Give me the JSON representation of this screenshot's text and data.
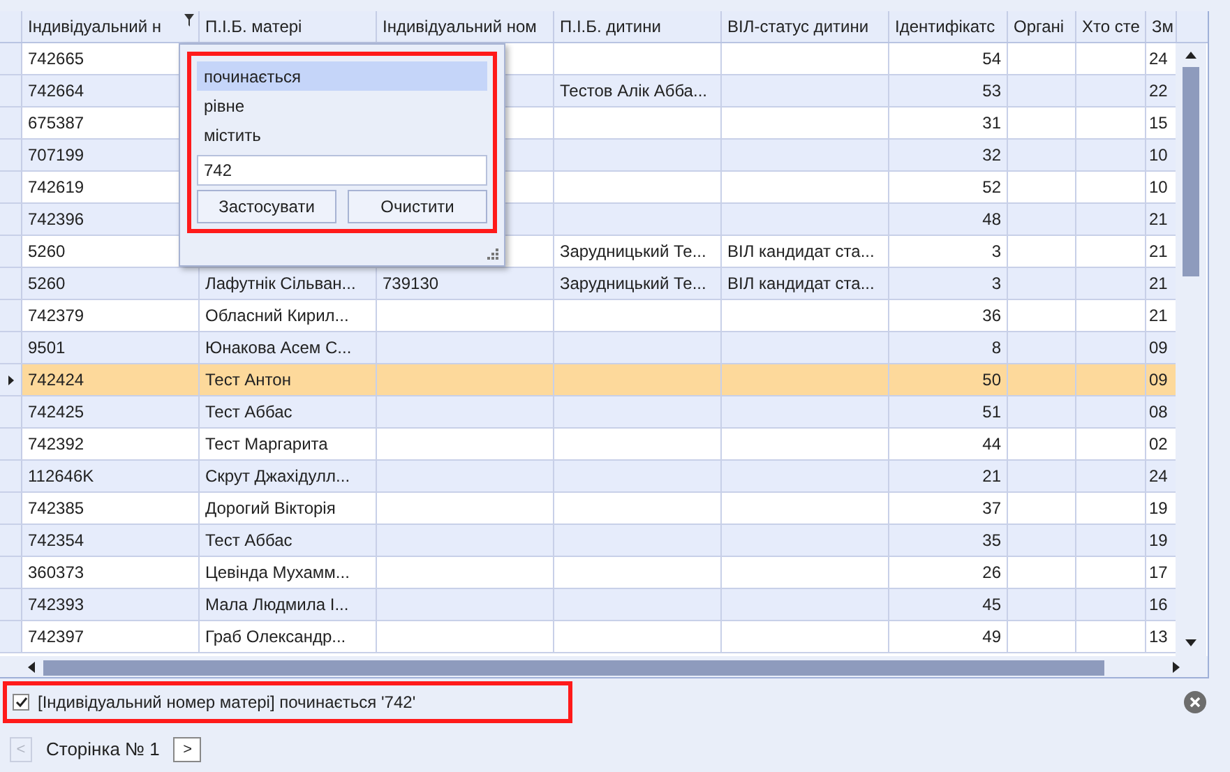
{
  "grid": {
    "columns": [
      {
        "label": "Індивідуальний н",
        "filtered": true,
        "kind": "text"
      },
      {
        "label": "П.І.Б. матері",
        "filtered": false,
        "kind": "text"
      },
      {
        "label": "Індивідуальний ном",
        "filtered": false,
        "kind": "text"
      },
      {
        "label": "П.І.Б. дитини",
        "filtered": false,
        "kind": "text"
      },
      {
        "label": "ВІЛ-статус дитини",
        "filtered": false,
        "kind": "text"
      },
      {
        "label": "Ідентифікатс",
        "filtered": false,
        "kind": "number"
      },
      {
        "label": "Органі",
        "filtered": false,
        "kind": "text"
      },
      {
        "label": "Хто сте",
        "filtered": false,
        "kind": "text"
      },
      {
        "label": "Зм",
        "filtered": false,
        "kind": "text"
      }
    ],
    "rows": [
      {
        "selected": false,
        "cells": [
          "742665",
          null,
          null,
          null,
          null,
          "54",
          null,
          null,
          "24"
        ]
      },
      {
        "selected": false,
        "cells": [
          "742664",
          null,
          null,
          "Тестов Алік Абба...",
          null,
          "53",
          null,
          null,
          "22"
        ]
      },
      {
        "selected": false,
        "cells": [
          "675387",
          null,
          null,
          null,
          null,
          "31",
          null,
          null,
          "15"
        ]
      },
      {
        "selected": false,
        "cells": [
          "707199",
          null,
          null,
          null,
          null,
          "32",
          null,
          null,
          "10"
        ]
      },
      {
        "selected": false,
        "cells": [
          "742619",
          null,
          null,
          null,
          null,
          "52",
          null,
          null,
          "10"
        ]
      },
      {
        "selected": false,
        "cells": [
          "742396",
          null,
          null,
          null,
          null,
          "48",
          null,
          null,
          "21"
        ]
      },
      {
        "selected": false,
        "cells": [
          "5260",
          null,
          null,
          "Зарудницький Те...",
          "ВІЛ кандидат ста...",
          "3",
          null,
          null,
          "21"
        ]
      },
      {
        "selected": false,
        "cells": [
          "5260",
          "Лафутнік Сільван...",
          "739130",
          "Зарудницький Те...",
          "ВІЛ кандидат ста...",
          "3",
          null,
          null,
          "21"
        ]
      },
      {
        "selected": false,
        "cells": [
          "742379",
          "Обласний Кирил...",
          null,
          null,
          null,
          "36",
          null,
          null,
          "21"
        ]
      },
      {
        "selected": false,
        "cells": [
          "9501",
          "Юнакова Асем С...",
          null,
          null,
          null,
          "8",
          null,
          null,
          "09"
        ]
      },
      {
        "selected": true,
        "cells": [
          "742424",
          "Тест Антон",
          null,
          null,
          null,
          "50",
          null,
          null,
          "09"
        ]
      },
      {
        "selected": false,
        "cells": [
          "742425",
          "Тест Аббас",
          null,
          null,
          null,
          "51",
          null,
          null,
          "08"
        ]
      },
      {
        "selected": false,
        "cells": [
          "742392",
          "Тест Маргарита",
          null,
          null,
          null,
          "44",
          null,
          null,
          "02"
        ]
      },
      {
        "selected": false,
        "cells": [
          "112646K",
          "Скрут Джахідулл...",
          null,
          null,
          null,
          "21",
          null,
          null,
          "24"
        ]
      },
      {
        "selected": false,
        "cells": [
          "742385",
          "Дорогий Вікторія",
          null,
          null,
          null,
          "37",
          null,
          null,
          "19"
        ]
      },
      {
        "selected": false,
        "cells": [
          "742354",
          "Тест Аббас",
          null,
          null,
          null,
          "35",
          null,
          null,
          "19"
        ]
      },
      {
        "selected": false,
        "cells": [
          "360373",
          "Цевінда Мухамм...",
          null,
          null,
          null,
          "26",
          null,
          null,
          "17"
        ]
      },
      {
        "selected": false,
        "cells": [
          "742393",
          "Мала Людмила І...",
          null,
          null,
          null,
          "45",
          null,
          null,
          "16"
        ]
      },
      {
        "selected": false,
        "cells": [
          "742397",
          "Граб Олександр...",
          null,
          null,
          null,
          "49",
          null,
          null,
          "13"
        ]
      }
    ]
  },
  "filter_popup": {
    "operators": [
      {
        "label": "починається",
        "selected": true
      },
      {
        "label": "рівне",
        "selected": false
      },
      {
        "label": "містить",
        "selected": false
      }
    ],
    "value": "742",
    "buttons": [
      "Застосувати",
      "Очистити"
    ]
  },
  "filter_bar": {
    "checked": true,
    "text": "[Індивідуальний номер матері] починається '742'"
  },
  "pager": {
    "prev": "<",
    "page": "Сторінка № 1",
    "next": ">",
    "prev_disabled": true
  }
}
